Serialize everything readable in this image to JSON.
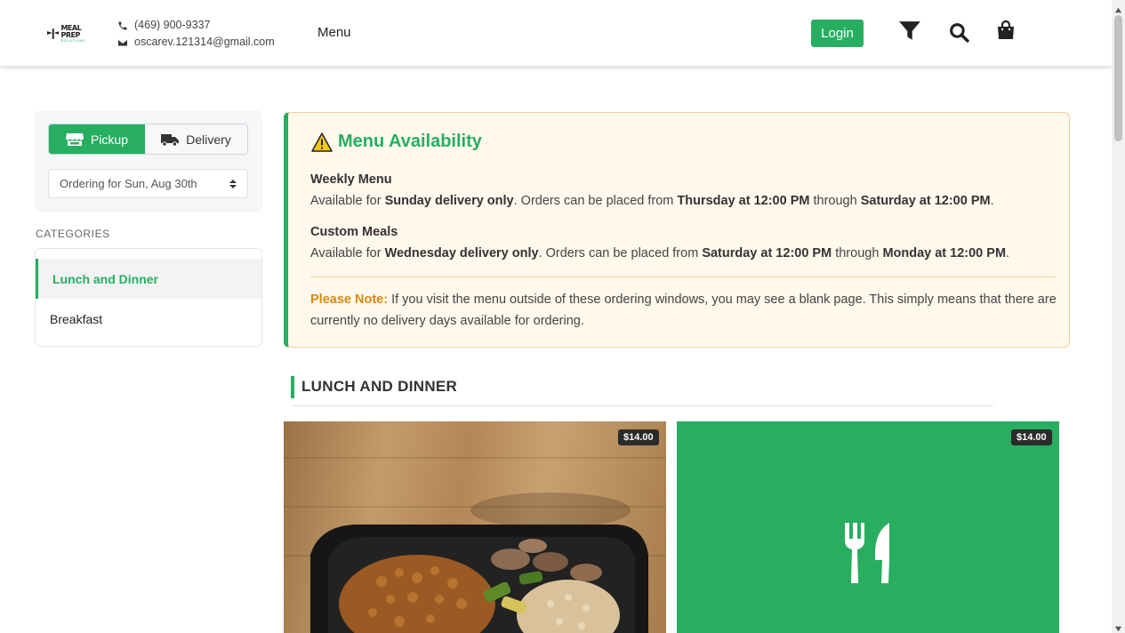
{
  "header": {
    "logo_main": "MEAL PREP",
    "logo_sub": "SOLUTIONS",
    "phone": "(469) 900-9337",
    "email": "oscarev.121314@gmail.com",
    "nav_menu": "Menu",
    "login_label": "Login",
    "icons": [
      "filter-icon",
      "search-icon",
      "shopping-bag-icon"
    ]
  },
  "order": {
    "pickup_label": "Pickup",
    "delivery_label": "Delivery",
    "selected_mode": "Pickup",
    "date_value": "Ordering for Sun, Aug 30th"
  },
  "categories": {
    "heading": "CATEGORIES",
    "items": [
      {
        "label": "Lunch and Dinner",
        "active": true
      },
      {
        "label": "Breakfast",
        "active": false
      }
    ]
  },
  "notice": {
    "title": "Menu Availability",
    "weekly": {
      "heading": "Weekly Menu",
      "t1": "Available for ",
      "b1": "Sunday delivery only",
      "t2": ". Orders can be placed from ",
      "b2": "Thursday at 12:00 PM",
      "t3": " through ",
      "b3": "Saturday at 12:00 PM",
      "t4": "."
    },
    "custom": {
      "heading": "Custom Meals",
      "t1": "Available for ",
      "b1": "Wednesday delivery only",
      "t2": ". Orders can be placed from ",
      "b2": "Saturday at 12:00 PM",
      "t3": " through ",
      "b3": "Monday at 12:00 PM",
      "t4": "."
    },
    "note_label": "Please Note:",
    "note_text": " If you visit the menu outside of these ordering windows, you may see a blank page. This simply means that there are currently no delivery days available for ordering."
  },
  "section": {
    "title": "LUNCH AND DINNER"
  },
  "products": [
    {
      "price": "$14.00",
      "image": "meal-container-photo"
    },
    {
      "price": "$14.00",
      "image": "utensils-icon"
    }
  ],
  "colors": {
    "brand_green": "#27ae60",
    "note_orange": "#d68910",
    "notice_bg": "#fff8ed"
  }
}
